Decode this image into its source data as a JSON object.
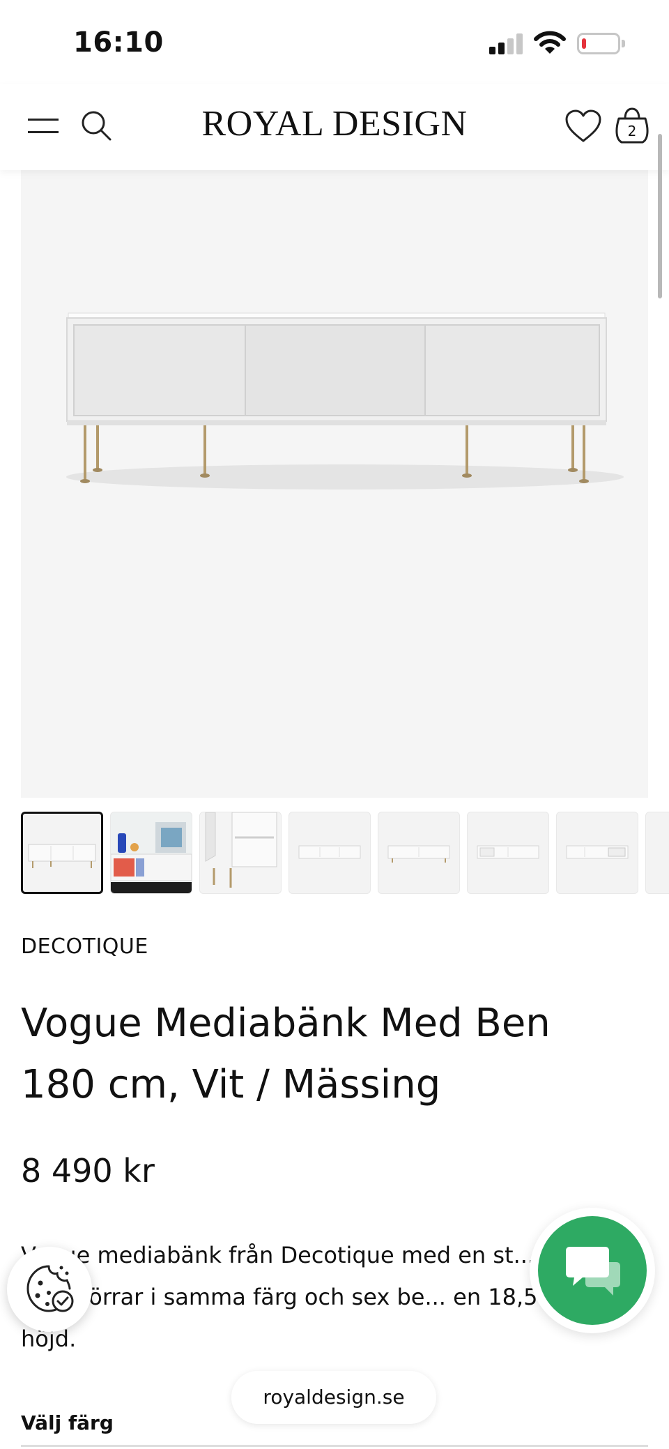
{
  "status_bar": {
    "time": "16:10",
    "battery_level": 0.1,
    "battery_color": "#e5323b",
    "icons": [
      "signal-icon",
      "wifi-icon",
      "battery-icon"
    ]
  },
  "header": {
    "logo": "ROYAL DESIGN",
    "cart_count": "2",
    "icons": [
      "menu-icon",
      "search-icon",
      "heart-icon",
      "bag-icon"
    ]
  },
  "gallery": {
    "thumbnail_count": 8,
    "active_index": 0,
    "more_hint": "3"
  },
  "product": {
    "brand": "DECOTIQUE",
    "title": "Vogue Mediabänk Med Ben 180 cm, Vit / Mässing",
    "price": "8 490 kr",
    "description": "Vogue mediabänk från Decotique med en st... tre skjutdörrar i samma färg och sex be... en 18,5 cm höjd.",
    "color_label": "Välj färg"
  },
  "floating": {
    "url": "royaldesign.se",
    "chat_color": "#2eaa63",
    "icons": [
      "cookie-icon",
      "chat-icon"
    ]
  }
}
